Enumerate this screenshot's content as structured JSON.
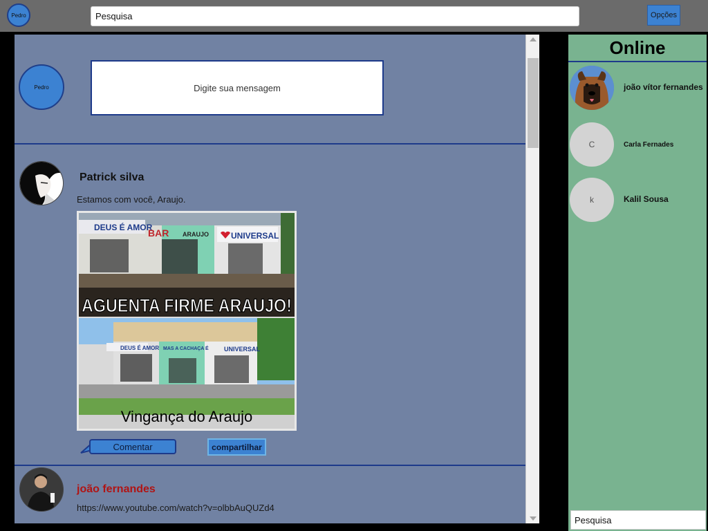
{
  "topbar": {
    "avatar_label": "Pedro",
    "search_value": "Pesquisa",
    "options_label": "Opções"
  },
  "composer": {
    "avatar_label": "Pedro",
    "message_placeholder": "Digite sua mensagem"
  },
  "posts": [
    {
      "author": "Patrick silva",
      "text": "Estamos com você, Araujo.",
      "image": {
        "caption_top": "AGUENTA FIRME ARAUJO!",
        "caption_bottom": "Vingança do Araujo",
        "sign_deus": "DEUS É AMOR",
        "sign_bar": "BAR",
        "sign_araujo": "ARAUJO",
        "sign_universal": "UNIVERSAL",
        "sign_cachaca": "MAS A CACHAÇA É"
      },
      "comment_label": "Comentar",
      "share_label": "compartilhar",
      "author_color": "#111111"
    },
    {
      "author": "joão fernandes",
      "text": "https://www.youtube.com/watch?v=olbbAuQUZd4",
      "author_color": "#b01414"
    }
  ],
  "online": {
    "title": "Online",
    "contacts": [
      {
        "name": "joão vítor fernandes",
        "initial": "",
        "avatar_icon": "dog-photo"
      },
      {
        "name": "Carla Fernades",
        "initial": "C"
      },
      {
        "name": "Kalil Sousa",
        "initial": "k"
      }
    ],
    "search_value": "Pesquisa"
  },
  "colors": {
    "feed_bg": "#7182a3",
    "online_bg": "#79b390",
    "accent_blue": "#3c82d2",
    "divider": "#1d3a8a"
  }
}
